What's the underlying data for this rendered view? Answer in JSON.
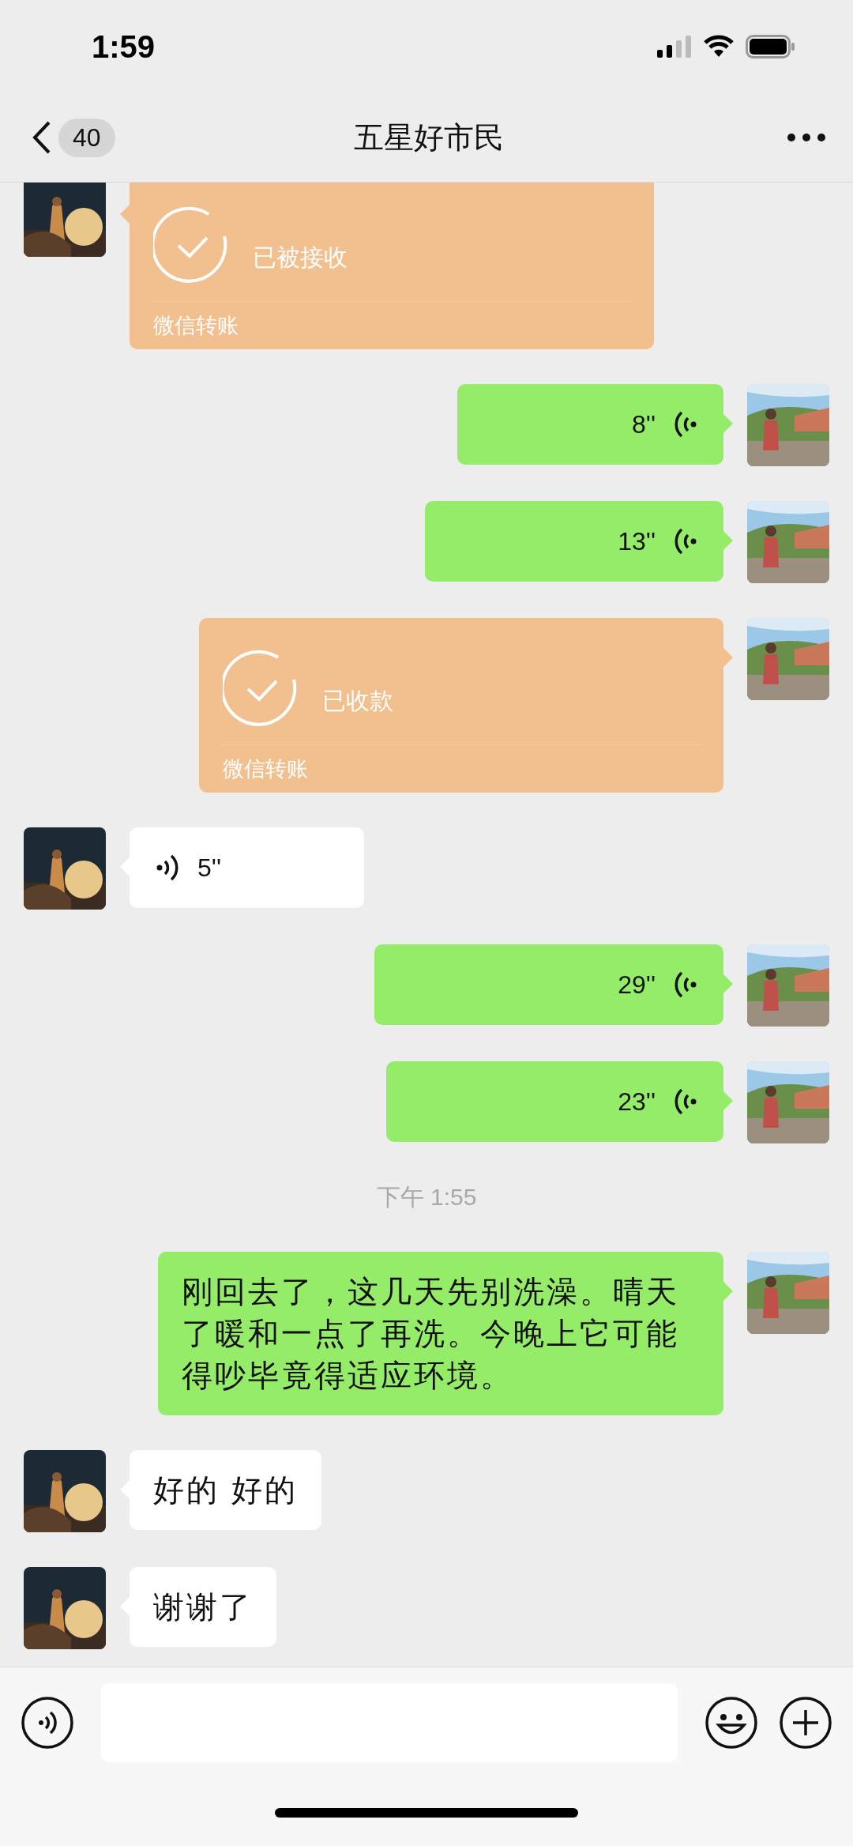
{
  "status_bar": {
    "time": "1:59"
  },
  "header": {
    "unread_count": "40",
    "title": "五星好市民"
  },
  "messages": [
    {
      "kind": "transfer",
      "outgoing": false,
      "status": "已被接收",
      "label": "微信转账"
    },
    {
      "kind": "voice",
      "outgoing": true,
      "duration": "8''"
    },
    {
      "kind": "voice",
      "outgoing": true,
      "duration": "13''"
    },
    {
      "kind": "transfer",
      "outgoing": true,
      "status": "已收款",
      "label": "微信转账"
    },
    {
      "kind": "voice",
      "outgoing": false,
      "duration": "5''"
    },
    {
      "kind": "voice",
      "outgoing": true,
      "duration": "29''"
    },
    {
      "kind": "voice",
      "outgoing": true,
      "duration": "23''"
    },
    {
      "kind": "time",
      "text": "下午 1:55"
    },
    {
      "kind": "text",
      "outgoing": true,
      "text": "刚回去了，这几天先别洗澡。晴天了暖和一点了再洗。今晚上它可能得吵毕竟得适应环境。"
    },
    {
      "kind": "text",
      "outgoing": false,
      "text": "好的 好的"
    },
    {
      "kind": "text",
      "outgoing": false,
      "text": "谢谢了"
    }
  ]
}
